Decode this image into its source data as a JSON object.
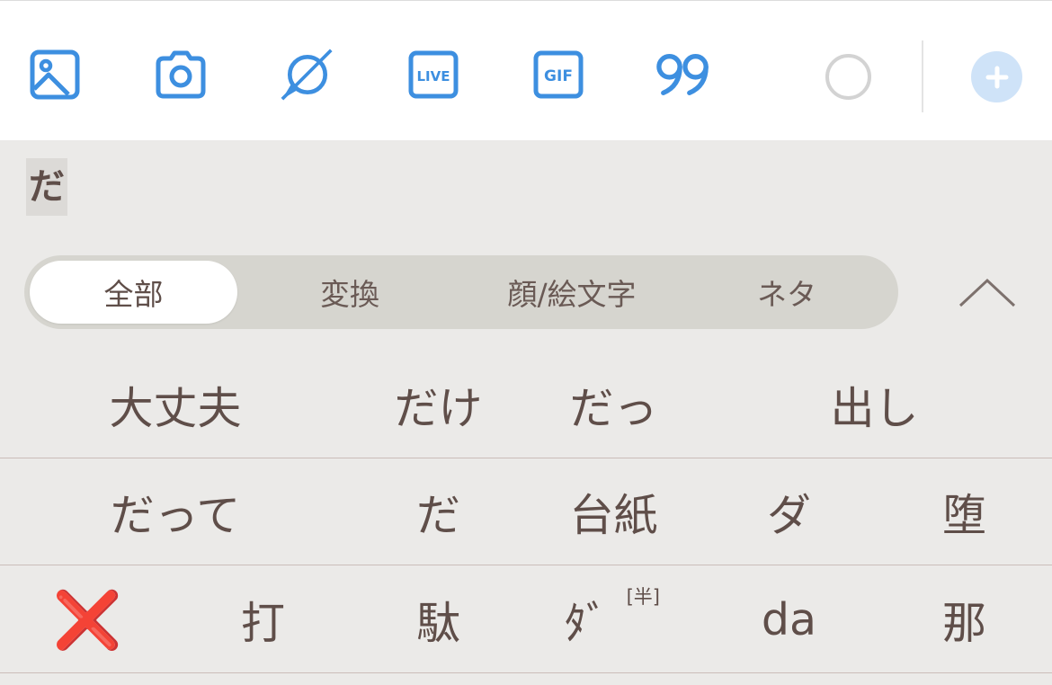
{
  "toolbar": {
    "icons": [
      {
        "name": "image-icon",
        "color": "#3d8fe0"
      },
      {
        "name": "camera-icon",
        "color": "#3d8fe0"
      },
      {
        "name": "poll-icon",
        "color": "#3d8fe0"
      },
      {
        "name": "live-icon",
        "label": "LIVE",
        "color": "#3d8fe0"
      },
      {
        "name": "gif-icon",
        "label": "GIF",
        "color": "#3d8fe0"
      },
      {
        "name": "quote-icon",
        "color": "#3d8fe0"
      }
    ],
    "progress_circle": "empty",
    "add_button_color": "#cfe3f8"
  },
  "keyboard": {
    "composing_text": "だ",
    "tabs": [
      {
        "label": "全部",
        "active": true
      },
      {
        "label": "変換",
        "active": false
      },
      {
        "label": "顔/絵文字",
        "active": false
      },
      {
        "label": "ネタ",
        "active": false
      }
    ],
    "collapse_icon": "chevron-up-icon",
    "candidates": [
      [
        "大丈夫",
        "だけ",
        "だっ",
        "出し"
      ],
      [
        "だって",
        "だ",
        "台紙",
        "ダ",
        "堕"
      ],
      [
        "❌",
        "打",
        "駄",
        "ﾀﾞ",
        "da",
        "那"
      ]
    ],
    "half_width_tag": "[半]"
  }
}
